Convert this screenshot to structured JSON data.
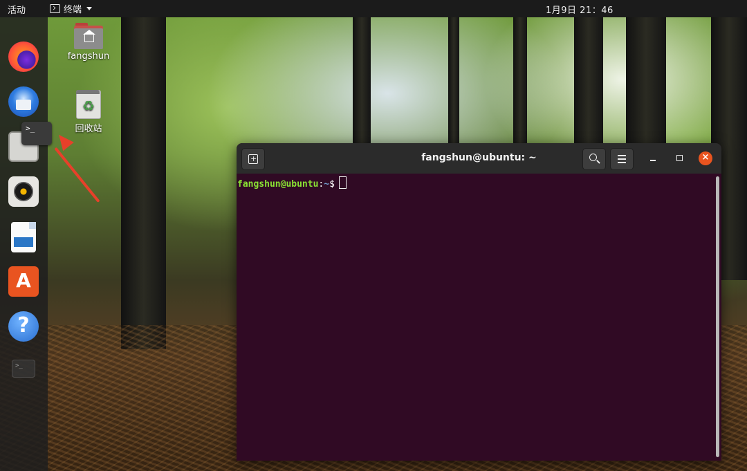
{
  "topbar": {
    "activities_label": "活动",
    "app_menu_label": "终端",
    "clock": "1月9日  21：46"
  },
  "dock": {
    "items": [
      {
        "name": "firefox-icon"
      },
      {
        "name": "thunderbird-icon"
      },
      {
        "name": "files-icon"
      },
      {
        "name": "rhythmbox-icon"
      },
      {
        "name": "libreoffice-writer-icon"
      },
      {
        "name": "software-icon",
        "glyph": "A"
      },
      {
        "name": "help-icon",
        "glyph": "?"
      },
      {
        "name": "terminal-icon"
      }
    ],
    "tooltip_glyph": ">_",
    "small_terminal_glyph": ">_"
  },
  "desktop": {
    "home_folder_label": "fangshun",
    "trash_label": "回收站"
  },
  "terminal": {
    "title": "fangshun@ubuntu: ~",
    "prompt_user": "fangshun@ubuntu",
    "prompt_colon": ":",
    "prompt_path": "~",
    "prompt_dollar": "$",
    "close_glyph": "×",
    "colors": {
      "background": "#300a24",
      "user": "#8ae234",
      "path": "#729fcf",
      "close": "#e9541f"
    }
  }
}
